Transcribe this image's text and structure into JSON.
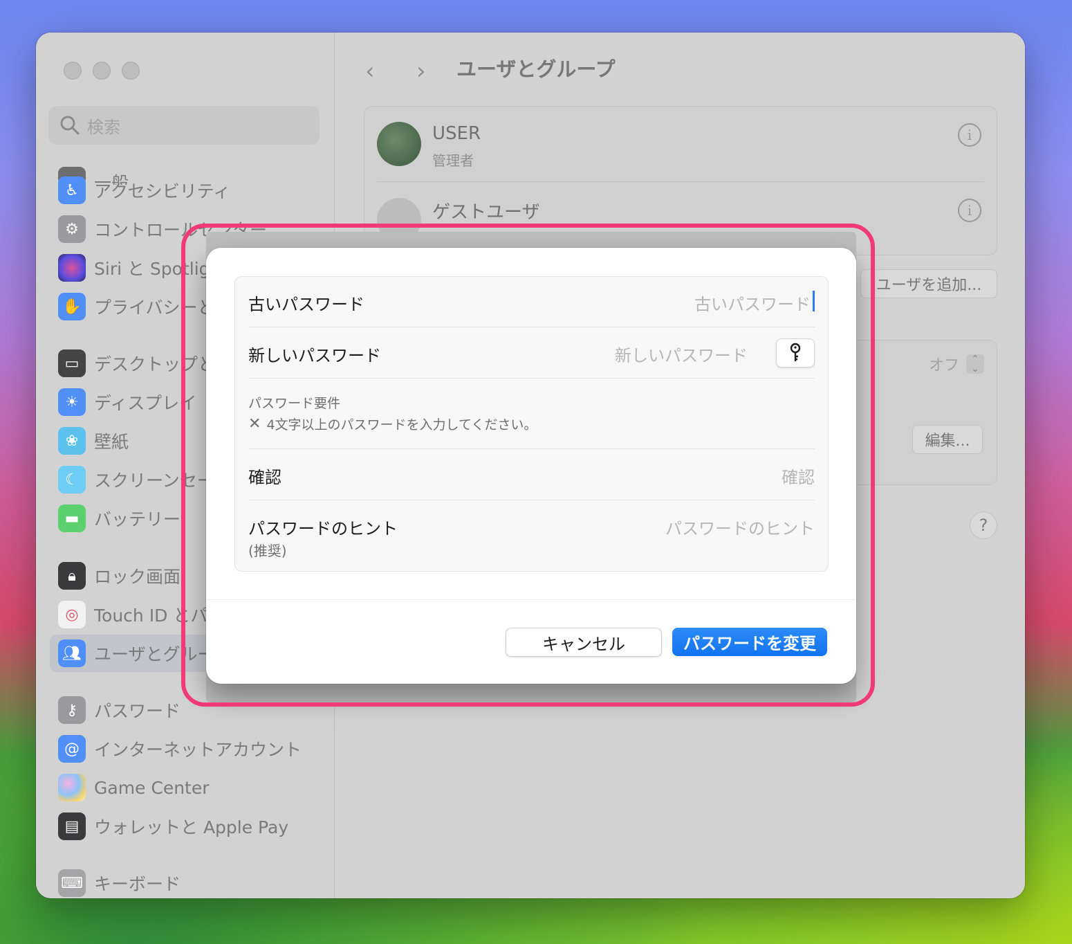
{
  "window": {
    "title": "ユーザとグループ"
  },
  "sidebar": {
    "search_placeholder": "検索",
    "partial_item": "一般",
    "items": [
      {
        "label": "アクセシビリティ",
        "icon": "accessibility-icon",
        "color": "#2f7cf6"
      },
      {
        "label": "コントロールセンター",
        "icon": "control-center-icon",
        "color": "#8e8e93"
      },
      {
        "label": "Siri と Spotlight",
        "icon": "siri-icon",
        "color": "#7a4ee6"
      },
      {
        "label": "プライバシーとセキュリティ",
        "icon": "hand-icon",
        "color": "#2f7cf6"
      },
      {
        "label": "デスクトップとDock",
        "icon": "desktop-icon",
        "color": "#2c2c2e"
      },
      {
        "label": "ディスプレイ",
        "icon": "sun-icon",
        "color": "#2f7cf6"
      },
      {
        "label": "壁紙",
        "icon": "flower-icon",
        "color": "#36b3e6"
      },
      {
        "label": "スクリーンセーバ",
        "icon": "screensaver-icon",
        "color": "#5ac8fa"
      },
      {
        "label": "バッテリー",
        "icon": "battery-icon",
        "color": "#34c759"
      },
      {
        "label": "ロック画面",
        "icon": "lock-icon",
        "color": "#2c2c2e"
      },
      {
        "label": "Touch ID とパスワード",
        "icon": "fingerprint-icon",
        "color": "#ffffff"
      },
      {
        "label": "ユーザとグループ",
        "icon": "users-icon",
        "color": "#2f7cf6"
      },
      {
        "label": "パスワード",
        "icon": "key-icon",
        "color": "#8e8e93"
      },
      {
        "label": "インターネットアカウント",
        "icon": "at-icon",
        "color": "#2f7cf6"
      },
      {
        "label": "Game Center",
        "icon": "game-center-icon",
        "color": "#ffffff"
      },
      {
        "label": "ウォレットと Apple Pay",
        "icon": "wallet-icon",
        "color": "#2c2c2e"
      },
      {
        "label": "キーボード",
        "icon": "keyboard-icon",
        "color": "#8e8e93"
      }
    ]
  },
  "main": {
    "users": [
      {
        "name": "USER",
        "role": "管理者"
      },
      {
        "name": "ゲストユーザ",
        "role": ""
      }
    ],
    "add_user_label": "ユーザを追加...",
    "auto_login_value": "オフ",
    "edit_label": "編集...",
    "help_label": "?",
    "info_label": "i"
  },
  "dialog": {
    "old_password_label": "古いパスワード",
    "old_password_placeholder": "古いパスワード",
    "new_password_label": "新しいパスワード",
    "new_password_placeholder": "新しいパスワード",
    "requirements_title": "パスワード要件",
    "requirements_text": "4文字以上のパスワードを入力してください。",
    "requirements_mark": "✕",
    "confirm_label": "確認",
    "confirm_placeholder": "確認",
    "hint_label": "パスワードのヒント",
    "hint_sublabel": "(推奨)",
    "hint_placeholder": "パスワードのヒント",
    "cancel_label": "キャンセル",
    "change_label": "パスワードを変更"
  },
  "colors": {
    "accent": "#1273f0",
    "highlight": "#f23a78"
  }
}
